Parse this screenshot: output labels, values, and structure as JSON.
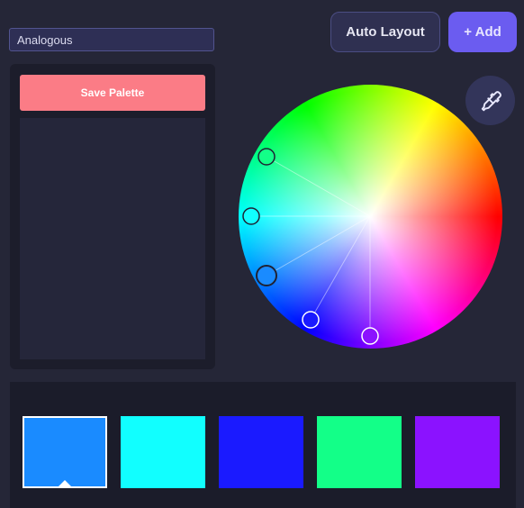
{
  "scheme_select": {
    "value": "Analogous"
  },
  "toolbar": {
    "auto_layout_label": "Auto Layout",
    "add_label": "+ Add"
  },
  "palette_panel": {
    "save_label": "Save Palette"
  },
  "icons": {
    "eyedropper": "eyedropper-icon"
  },
  "colors": {
    "background": "#252637",
    "panel": "#1c1d2b",
    "accent": "#6b5cf0",
    "save_button": "#fb7c86"
  },
  "color_wheel": {
    "handles": [
      {
        "name": "handle-1",
        "color": "#1a8bff",
        "selected": true
      },
      {
        "name": "handle-2",
        "color": "#11ffff",
        "selected": false
      },
      {
        "name": "handle-3",
        "color": "#1a1aff",
        "selected": false
      },
      {
        "name": "handle-4",
        "color": "#13ff88",
        "selected": false
      },
      {
        "name": "handle-5",
        "color": "#8b12ff",
        "selected": false
      }
    ]
  },
  "swatches": [
    {
      "color": "#1a8bff",
      "selected": true
    },
    {
      "color": "#11ffff",
      "selected": false
    },
    {
      "color": "#1a1aff",
      "selected": false
    },
    {
      "color": "#13ff88",
      "selected": false
    },
    {
      "color": "#8b12ff",
      "selected": false
    }
  ]
}
